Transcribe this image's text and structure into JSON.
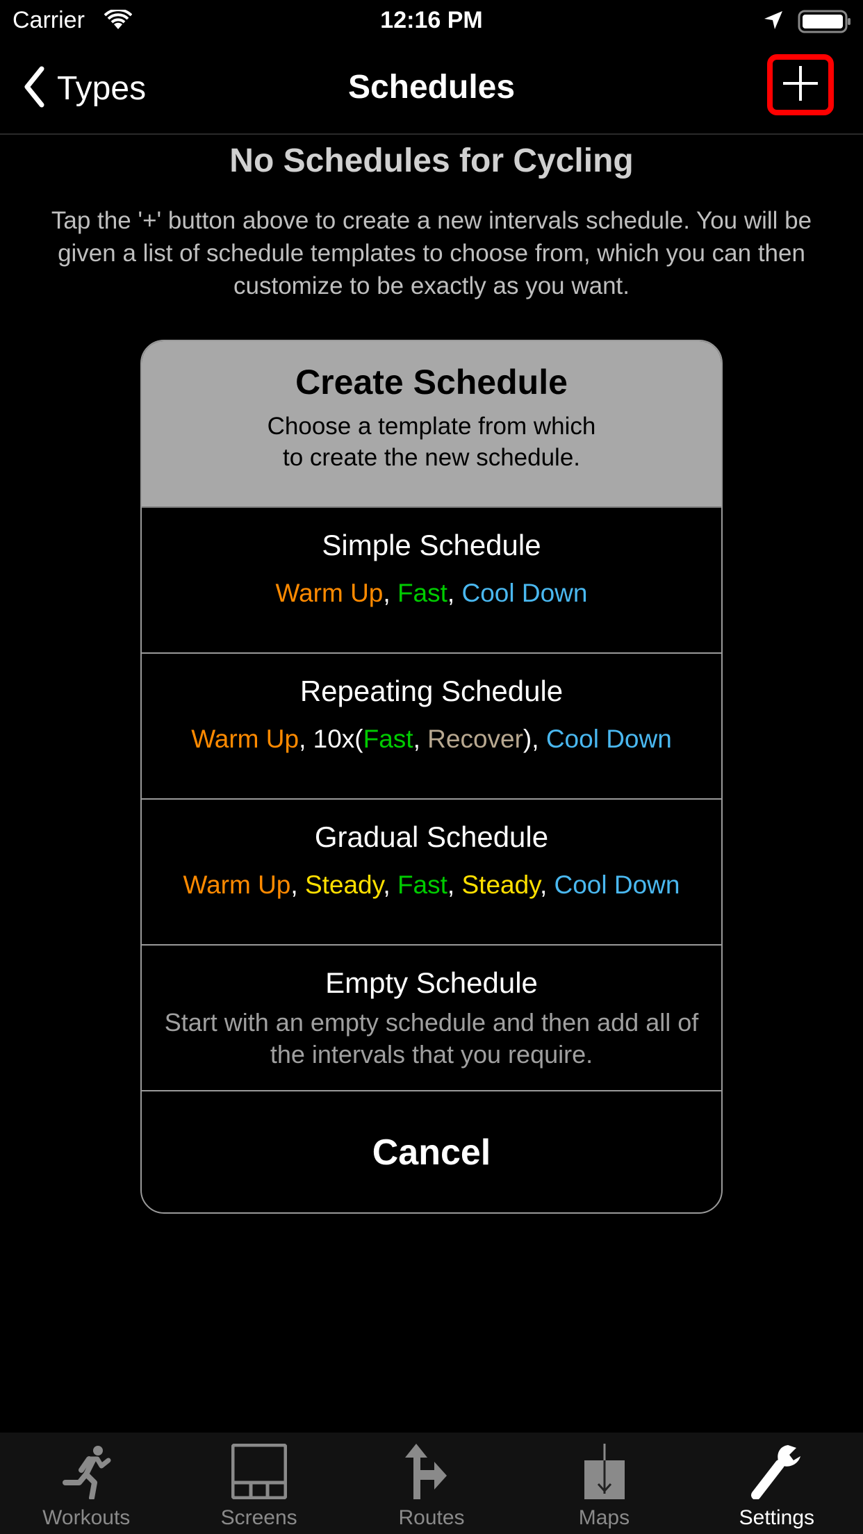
{
  "status_bar": {
    "carrier": "Carrier",
    "time": "12:16 PM"
  },
  "nav": {
    "back_label": "Types",
    "title": "Schedules",
    "add_label": "+"
  },
  "empty_state": {
    "title": "No Schedules for Cycling",
    "description": "Tap the '+' button above to create a new intervals schedule. You will be given a list of schedule templates to choose from, which you can then customize to be exactly as you want."
  },
  "sheet": {
    "title": "Create Schedule",
    "subtitle_line1": "Choose a template from which",
    "subtitle_line2": "to create the new schedule.",
    "options": [
      {
        "title": "Simple Schedule",
        "segments": [
          {
            "text": "Warm Up",
            "color": "#ff8a00"
          },
          {
            "text": ", ",
            "color": "#ffffff"
          },
          {
            "text": "Fast",
            "color": "#00cc00"
          },
          {
            "text": ", ",
            "color": "#ffffff"
          },
          {
            "text": "Cool Down",
            "color": "#4ab8f0"
          }
        ]
      },
      {
        "title": "Repeating Schedule",
        "segments": [
          {
            "text": "Warm Up",
            "color": "#ff8a00"
          },
          {
            "text": ", 10x(",
            "color": "#ffffff"
          },
          {
            "text": "Fast",
            "color": "#00cc00"
          },
          {
            "text": ", ",
            "color": "#ffffff"
          },
          {
            "text": "Recover",
            "color": "#b8a890"
          },
          {
            "text": "), ",
            "color": "#ffffff"
          },
          {
            "text": "Cool Down",
            "color": "#4ab8f0"
          }
        ]
      },
      {
        "title": "Gradual Schedule",
        "segments": [
          {
            "text": "Warm Up",
            "color": "#ff8a00"
          },
          {
            "text": ", ",
            "color": "#ffffff"
          },
          {
            "text": "Steady",
            "color": "#ffe000"
          },
          {
            "text": ", ",
            "color": "#ffffff"
          },
          {
            "text": "Fast",
            "color": "#00cc00"
          },
          {
            "text": ", ",
            "color": "#ffffff"
          },
          {
            "text": "Steady",
            "color": "#ffe000"
          },
          {
            "text": ", ",
            "color": "#ffffff"
          },
          {
            "text": "Cool Down",
            "color": "#4ab8f0"
          }
        ]
      },
      {
        "title": "Empty Schedule",
        "description": "Start with an empty schedule and then add all of the intervals that you require."
      }
    ],
    "cancel_label": "Cancel"
  },
  "tabs": [
    {
      "label": "Workouts",
      "icon": "running-icon",
      "active": false
    },
    {
      "label": "Screens",
      "icon": "screens-icon",
      "active": false
    },
    {
      "label": "Routes",
      "icon": "routes-icon",
      "active": false
    },
    {
      "label": "Maps",
      "icon": "maps-download-icon",
      "active": false
    },
    {
      "label": "Settings",
      "icon": "wrench-icon",
      "active": true
    }
  ],
  "colors": {
    "highlight": "#ff0000",
    "header_bg": "#a8a8a8",
    "tab_inactive": "#8a8a8a",
    "tab_active": "#ffffff"
  }
}
